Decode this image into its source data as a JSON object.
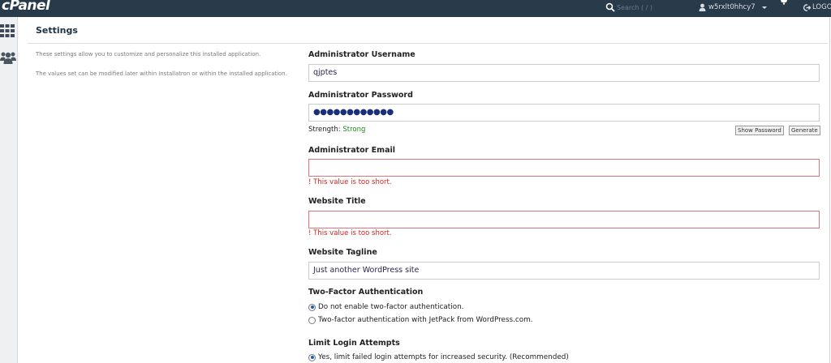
{
  "topbar": {
    "logo": "cPanel",
    "search_placeholder": "Search ( / )",
    "username": "w5rxlt0hhcy7",
    "logout_label": "LOGOUT"
  },
  "page": {
    "title": "Settings",
    "description_1": "These settings allow you to customize and personalize this installed application.",
    "description_2": "The values set can be modified later within Installatron or within the installed application."
  },
  "form": {
    "admin_username": {
      "label": "Administrator Username",
      "value": "qjptes"
    },
    "admin_password": {
      "label": "Administrator Password",
      "value": "●●●●●●●●●●●●"
    },
    "strength_label": "Strength:",
    "strength_value": "Strong",
    "show_password_button": "Show Password",
    "generate_button": "Generate",
    "admin_email": {
      "label": "Administrator Email",
      "value": "",
      "error": "! This value is too short."
    },
    "website_title": {
      "label": "Website Title",
      "value": "",
      "error": "! This value is too short."
    },
    "website_tagline": {
      "label": "Website Tagline",
      "value": "Just another WordPress site"
    },
    "two_factor": {
      "label": "Two-Factor Authentication",
      "options": [
        {
          "label": "Do not enable two-factor authentication.",
          "checked": true
        },
        {
          "label": "Two-factor authentication with JetPack from WordPress.com.",
          "checked": false
        }
      ]
    },
    "limit_login": {
      "label": "Limit Login Attempts",
      "options": [
        {
          "label": "Yes, limit failed login attempts for increased security. (Recommended)",
          "checked": true
        }
      ]
    }
  },
  "colors": {
    "topbar_bg": "#293a4a",
    "error_red": "#d9211b",
    "strength_green": "#1f8a1f",
    "radio_blue": "#1d5fb8"
  }
}
